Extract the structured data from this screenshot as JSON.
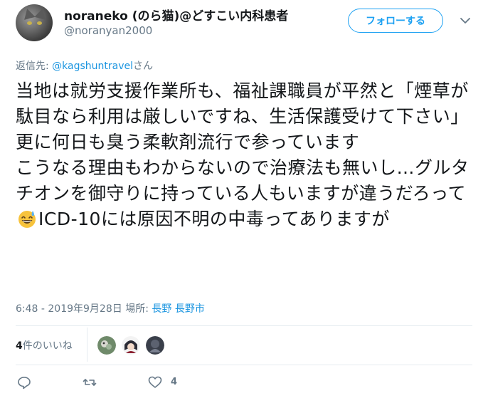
{
  "user": {
    "display_name": "noraneko (のら猫)@どすこい内科患者",
    "handle": "@noranyan2000"
  },
  "follow_button_label": "フォローする",
  "reply": {
    "prefix": "返信先: ",
    "mention": "@kagshuntravel",
    "suffix": "さん"
  },
  "tweet": {
    "text_before_emoji": "当地は就労支援作業所も、福祉課職員が平然と「煙草が駄目なら利用は厳しいですね、生活保護受けて下さい」\n更に何日も臭う柔軟剤流行で参っています\nこうなる理由もわからないので治療法も無いし…グルタチオンを御守りに持っている人もいますが違うだろって",
    "text_after_emoji": "ICD-10には原因不明の中毒ってありますが",
    "emoji": "grinning-sweat-emoji"
  },
  "meta": {
    "timestamp": "6:48 - 2019年9月28日",
    "place_prefix": " 場所: ",
    "place": "長野 長野市"
  },
  "likes": {
    "count": "4",
    "label": "件のいいね"
  },
  "actions": {
    "like_count": "4"
  },
  "colors": {
    "accent": "#1da1f2",
    "link": "#1b95e0",
    "muted": "#657786",
    "text": "#14171a",
    "divider": "#e6ecf0"
  },
  "icons": [
    "chevron-down-icon",
    "reply-icon",
    "retweet-icon",
    "heart-icon"
  ]
}
